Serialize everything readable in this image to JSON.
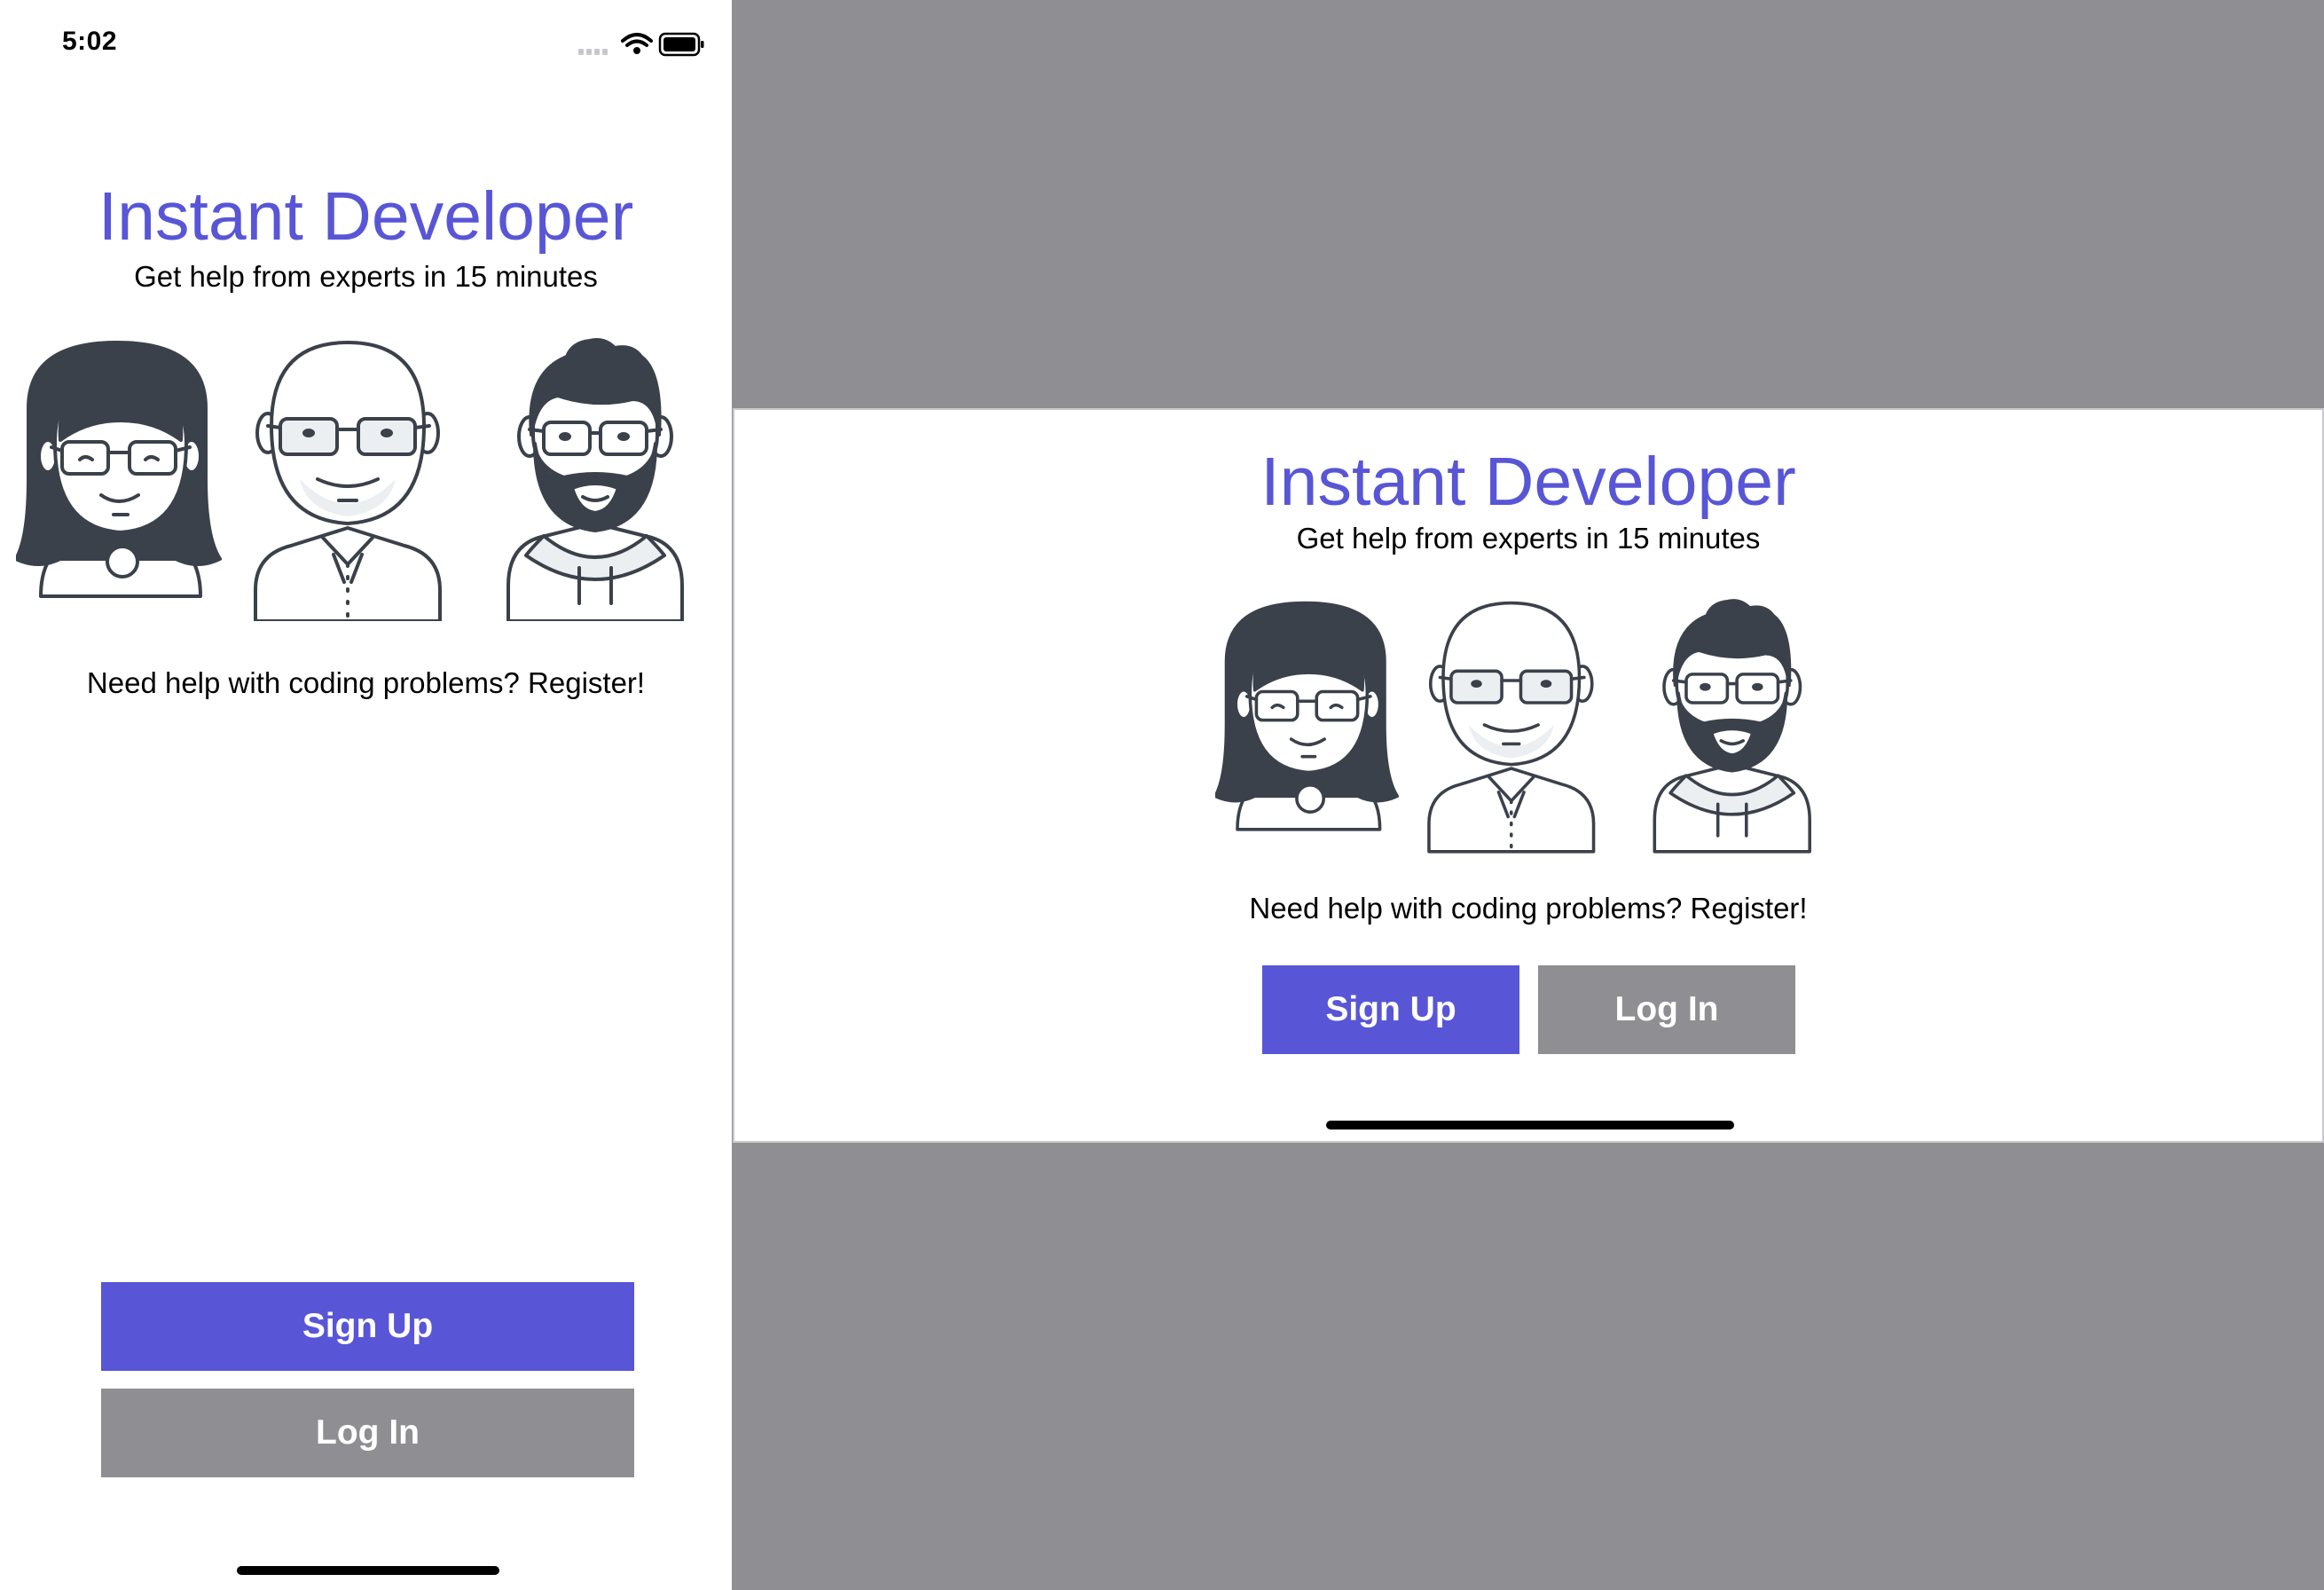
{
  "status_bar": {
    "time": "5:02",
    "icons": [
      "cellular-signal-icon",
      "wifi-icon",
      "battery-icon"
    ]
  },
  "app": {
    "title": "Instant Developer",
    "subtitle": "Get help from experts in 15 minutes",
    "prompt": "Need help with coding problems? Register!",
    "sign_up_label": "Sign Up",
    "log_in_label": "Log In",
    "developers": [
      "woman-developer-avatar",
      "bald-developer-avatar",
      "bearded-developer-avatar"
    ]
  },
  "colors": {
    "accent": "#5856d6",
    "secondary_button": "#8e8e93",
    "background_outside": "#8e8e93",
    "illustration_stroke": "#3b414b",
    "text": "#000000"
  }
}
